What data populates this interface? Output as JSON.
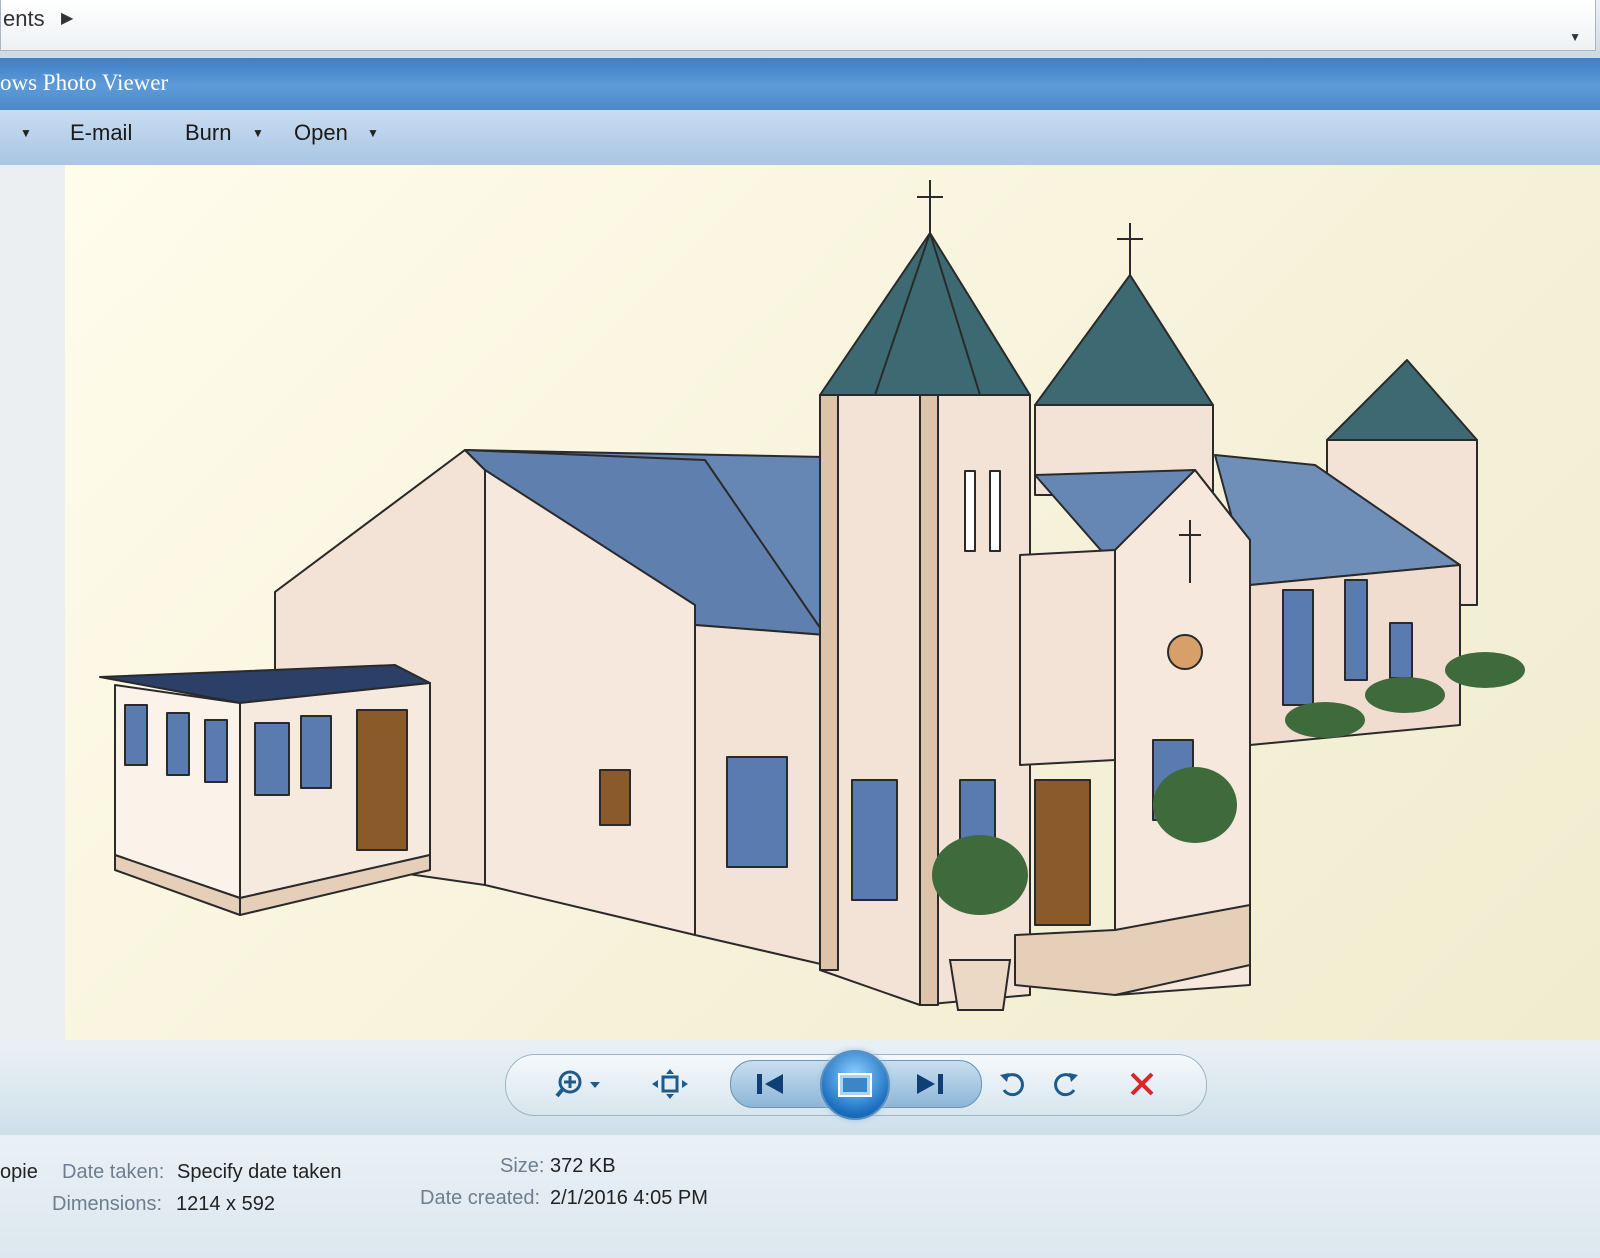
{
  "address_bar": {
    "breadcrumb": "ents"
  },
  "window": {
    "title": "ows Photo Viewer"
  },
  "menu": {
    "email": "E-mail",
    "burn": "Burn",
    "open": "Open"
  },
  "toolbar": {
    "zoom_icon": "zoom-icon",
    "fit_icon": "actual-size-icon",
    "prev_icon": "previous-icon",
    "slideshow_icon": "slideshow-icon",
    "next_icon": "next-icon",
    "rotate_ccw_icon": "rotate-counterclockwise-icon",
    "rotate_cw_icon": "rotate-clockwise-icon",
    "delete_icon": "delete-icon",
    "delete_color": "#d9262c"
  },
  "details": {
    "name": "opie",
    "date_taken_label": "Date taken:",
    "date_taken_value": "Specify date taken",
    "dimensions_label": "Dimensions:",
    "dimensions_value": "1214 x 592",
    "size_label": "Size:",
    "size_value": "372 KB",
    "date_created_label": "Date created:",
    "date_created_value": "2/1/2016 4:05 PM"
  }
}
